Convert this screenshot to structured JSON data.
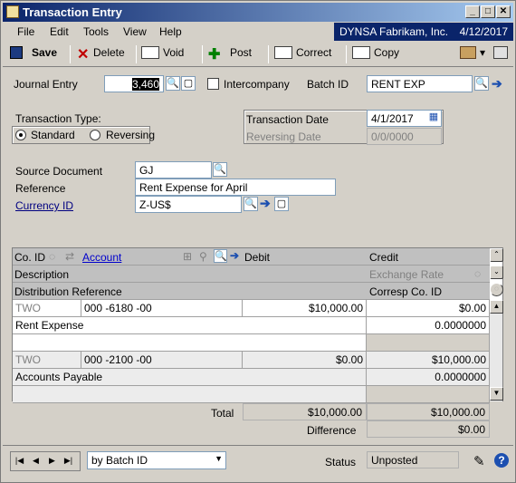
{
  "window": {
    "title": "Transaction Entry"
  },
  "menu": {
    "file": "File",
    "edit": "Edit",
    "tools": "Tools",
    "view": "View",
    "help": "Help",
    "company": "DYNSA  Fabrikam, Inc.",
    "date": "4/12/2017"
  },
  "toolbar": {
    "save": "Save",
    "delete": "Delete",
    "void": "Void",
    "post": "Post",
    "correct": "Correct",
    "copy": "Copy"
  },
  "form": {
    "journal_entry_label": "Journal Entry",
    "journal_entry_value": "3,460",
    "intercompany_label": "Intercompany",
    "batch_id_label": "Batch ID",
    "batch_id_value": "RENT EXP",
    "transaction_type_label": "Transaction Type:",
    "standard_label": "Standard",
    "reversing_label": "Reversing",
    "transaction_date_label": "Transaction Date",
    "transaction_date_value": "4/1/2017",
    "reversing_date_label": "Reversing Date",
    "reversing_date_value": "0/0/0000",
    "source_document_label": "Source Document",
    "source_document_value": "GJ",
    "reference_label": "Reference",
    "reference_value": "Rent Expense for April",
    "currency_id_label": "Currency ID",
    "currency_id_value": "Z-US$"
  },
  "grid": {
    "h_coid": "Co. ID",
    "h_account": "Account",
    "h_debit": "Debit",
    "h_credit": "Credit",
    "h_description": "Description",
    "h_exchange_rate": "Exchange Rate",
    "h_dist_ref": "Distribution Reference",
    "h_corresp": "Corresp Co. ID",
    "rows": [
      {
        "coid": "TWO",
        "account": "000 -6180 -00",
        "debit": "$10,000.00",
        "credit": "$0.00",
        "description": "Rent Expense",
        "rate": "0.0000000"
      },
      {
        "coid": "TWO",
        "account": "000 -2100 -00",
        "debit": "$0.00",
        "credit": "$10,000.00",
        "description": "Accounts Payable",
        "rate": "0.0000000"
      }
    ]
  },
  "totals": {
    "total_label": "Total",
    "total_debit": "$10,000.00",
    "total_credit": "$10,000.00",
    "difference_label": "Difference",
    "difference_value": "$0.00"
  },
  "footer": {
    "sort_value": "by Batch ID",
    "status_label": "Status",
    "status_value": "Unposted"
  }
}
